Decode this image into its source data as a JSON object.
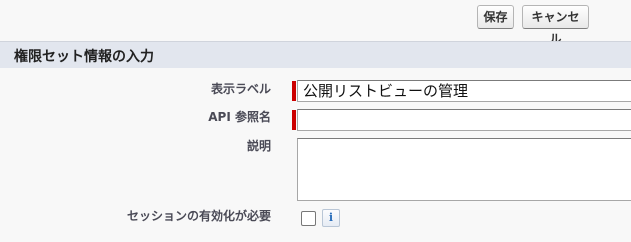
{
  "toolbar": {
    "save_label": "保存",
    "cancel_label": "キャンセル"
  },
  "section": {
    "title": "権限セット情報の入力"
  },
  "fields": {
    "label": {
      "label": "表示ラベル",
      "value": "公開リストビューの管理",
      "required": true
    },
    "api_name": {
      "label": "API 参照名",
      "value": "",
      "required": true
    },
    "description": {
      "label": "説明",
      "value": ""
    },
    "session_activation": {
      "label": "セッションの有効化が必要",
      "checked": false,
      "info_icon": "info-icon",
      "info_glyph": "i"
    }
  },
  "colors": {
    "required_marker": "#cc0000",
    "section_header_bg": "#e2e6ee",
    "info_icon": "#2a6ebb"
  }
}
